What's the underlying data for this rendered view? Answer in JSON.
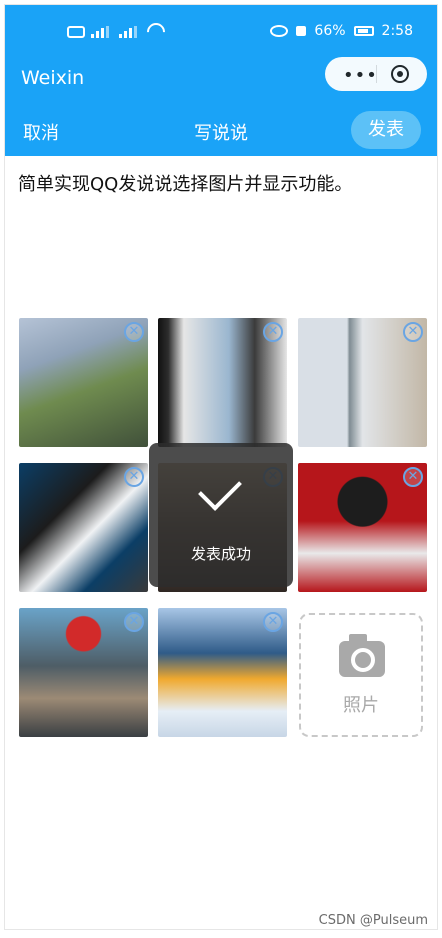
{
  "status": {
    "battery_text": "66%",
    "time": "2:58",
    "left_icons": [
      "hd-icon",
      "signal-3g-icon",
      "signal-4g-icon",
      "wifi-icon"
    ],
    "right_icons": [
      "eye-icon",
      "mute-icon",
      "battery-icon"
    ]
  },
  "app": {
    "title": "Weixin",
    "capsule": {
      "menu_icon": "more-dots-icon",
      "close_icon": "target-icon"
    }
  },
  "nav": {
    "cancel": "取消",
    "title": "写说说",
    "publish": "发表"
  },
  "post": {
    "text": "简单实现QQ发说说选择图片并显示功能。"
  },
  "photos": [
    {
      "label": "photo-1",
      "colors": [
        "#8fa2b8",
        "#6f8b4f",
        "#40503a"
      ]
    },
    {
      "label": "photo-2",
      "colors": [
        "#e6e6e6",
        "#2d2d2d",
        "#9ab6cf"
      ]
    },
    {
      "label": "photo-3",
      "colors": [
        "#d9dfe6",
        "#7f8c93",
        "#c2b7a6"
      ]
    },
    {
      "label": "photo-4",
      "colors": [
        "#0b3e66",
        "#f0f2f4",
        "#3a3a3a"
      ]
    },
    {
      "label": "photo-5",
      "colors": [
        "#6e5b4a",
        "#c9b293",
        "#2f2723"
      ]
    },
    {
      "label": "photo-6",
      "colors": [
        "#b6161b",
        "#e9e9ea",
        "#1d1d1d"
      ]
    },
    {
      "label": "photo-7",
      "colors": [
        "#4e5d66",
        "#d22a2a",
        "#9c8a75"
      ]
    },
    {
      "label": "photo-8",
      "colors": [
        "#a8c6e6",
        "#f0a92e",
        "#2f5b88"
      ]
    }
  ],
  "add_photo": {
    "label": "照片",
    "icon": "camera-icon"
  },
  "toast": {
    "message": "发表成功",
    "icon": "checkmark-icon"
  },
  "watermark": "CSDN @Pulseum"
}
